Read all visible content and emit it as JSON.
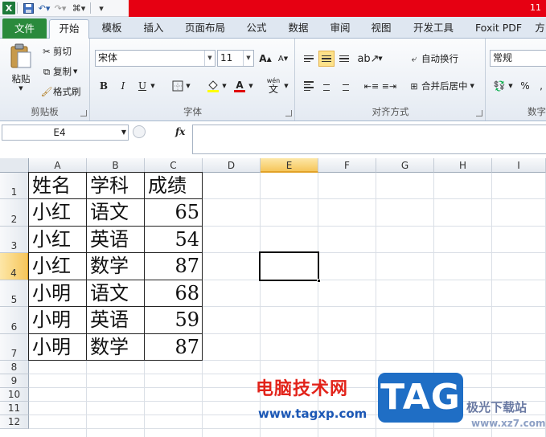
{
  "titlebar": {
    "title_partial": "11"
  },
  "tabs": [
    {
      "label": "文件"
    },
    {
      "label": "开始"
    },
    {
      "label": "模板"
    },
    {
      "label": "插入"
    },
    {
      "label": "页面布局"
    },
    {
      "label": "公式"
    },
    {
      "label": "数据"
    },
    {
      "label": "审阅"
    },
    {
      "label": "视图"
    },
    {
      "label": "开发工具"
    },
    {
      "label": "Foxit PDF"
    },
    {
      "label": "方"
    }
  ],
  "ribbon": {
    "clipboard": {
      "paste": "粘贴",
      "cut": "剪切",
      "copy": "复制",
      "format_painter": "格式刷",
      "label": "剪贴板"
    },
    "font": {
      "name": "宋体",
      "size": "11",
      "bold": "B",
      "italic": "I",
      "underline": "U",
      "label": "字体",
      "font_color_letter": "A",
      "wen": "wén",
      "wen_char": "文"
    },
    "alignment": {
      "wrap": "自动换行",
      "merge": "合并后居中",
      "label": "对齐方式"
    },
    "number": {
      "format": "常规",
      "percent": "%",
      "label": "数字"
    }
  },
  "formula_bar": {
    "name_box": "E4",
    "fx": "fx",
    "formula": ""
  },
  "columns": [
    "A",
    "B",
    "C",
    "D",
    "E",
    "F",
    "G",
    "H",
    "I"
  ],
  "rows": [
    "1",
    "2",
    "3",
    "4",
    "5",
    "6",
    "7",
    "8",
    "9",
    "10",
    "11",
    "12"
  ],
  "selected": {
    "column": "E",
    "row": "4"
  },
  "table": {
    "headers": [
      "姓名",
      "学科",
      "成绩"
    ],
    "rows": [
      [
        "小红",
        "语文",
        "65"
      ],
      [
        "小红",
        "英语",
        "54"
      ],
      [
        "小红",
        "数学",
        "87"
      ],
      [
        "小明",
        "语文",
        "68"
      ],
      [
        "小明",
        "英语",
        "59"
      ],
      [
        "小明",
        "数学",
        "87"
      ]
    ]
  },
  "watermark": {
    "site_cn": "电脑技术网",
    "url": "www.tagxp.com",
    "tag": "TAG",
    "right_cn": "极光下载站",
    "right_url": "www.xz7.com"
  }
}
